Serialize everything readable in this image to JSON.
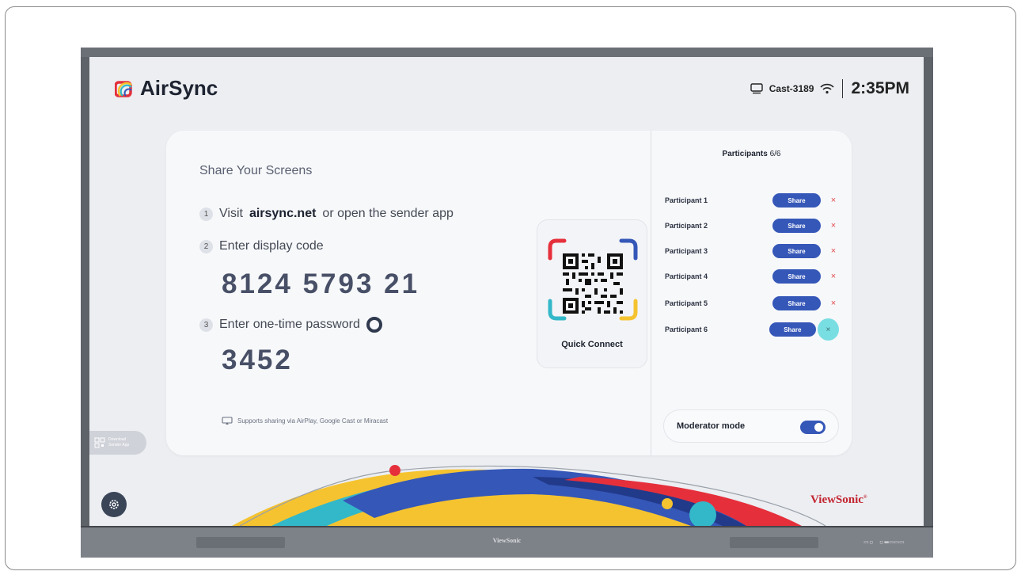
{
  "app": {
    "name": "AirSync",
    "device_code": "Cast-3189",
    "time": "2:35PM"
  },
  "share": {
    "title": "Share Your Screens",
    "steps": [
      {
        "num": "1",
        "prefix": "Visit",
        "link": "airsync.net",
        "suffix": "or open the sender app"
      },
      {
        "num": "2",
        "text": "Enter display code"
      },
      {
        "num": "3",
        "text": "Enter one-time password"
      }
    ],
    "display_code": "8124 5793 21",
    "password": "3452",
    "support_text": "Supports sharing via AirPlay, Google Cast or Miracast",
    "quick_connect_label": "Quick Connect"
  },
  "participants": {
    "title": "Participants",
    "count": "6/6",
    "share_label": "Share",
    "remove_symbol": "×",
    "items": [
      {
        "name": "Participant 1"
      },
      {
        "name": "Participant 2"
      },
      {
        "name": "Participant 3"
      },
      {
        "name": "Participant 4"
      },
      {
        "name": "Participant 5"
      },
      {
        "name": "Participant 6"
      }
    ],
    "moderator_label": "Moderator mode",
    "moderator_on": true
  },
  "sidebar": {
    "download_label_1": "Download",
    "download_label_2": "Sender App"
  },
  "brand": {
    "name": "ViewSonic",
    "registered": "®",
    "chin_brand": "ViewSonic",
    "chin_ports": "▭▫ ▫▬▭▭▭"
  },
  "colors": {
    "accent": "#3557b8",
    "remove": "#e24c4c",
    "brand_red": "#c42430",
    "highlight": "#4ed5da"
  },
  "icons": {
    "device": "monitor-icon",
    "wifi": "wifi-icon",
    "settings": "gear-icon",
    "cast": "cast-icon"
  }
}
